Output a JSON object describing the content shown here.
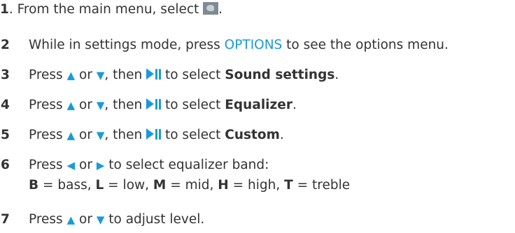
{
  "steps": [
    {
      "number": "1",
      "parts": {
        "prefix": "1",
        "text": ". From the main menu, select",
        "suffix": "."
      },
      "icon": "settings-menu-icon"
    },
    {
      "number": "2",
      "text_before": "While in settings mode, press ",
      "accent": "OPTIONS",
      "text_after": " to see the options menu."
    },
    {
      "number": "3",
      "press": "Press ",
      "or": " or ",
      "then": ", then ",
      "to_select": " to select ",
      "target": "Sound settings",
      "end": "."
    },
    {
      "number": "4",
      "press": "Press ",
      "or": " or ",
      "then": ", then ",
      "to_select": " to select ",
      "target": "Equalizer",
      "end": "."
    },
    {
      "number": "5",
      "press": "Press ",
      "or": " or ",
      "then": ", then ",
      "to_select": " to select ",
      "target": "Custom",
      "end": "."
    },
    {
      "number": "6",
      "line1_press": "Press ",
      "line1_or": " or ",
      "line1_rest": " to select equalizer band:",
      "bands": [
        {
          "key": "B",
          "label": " = bass"
        },
        {
          "key": "L",
          "label": " = low"
        },
        {
          "key": "M",
          "label": " = mid"
        },
        {
          "key": "H",
          "label": " = high"
        },
        {
          "key": "T",
          "label": " = treble"
        }
      ],
      "sep": ", "
    },
    {
      "number": "7",
      "press": "Press ",
      "or": " or ",
      "rest": " to adjust level."
    }
  ],
  "symbols": {
    "up": "▲",
    "down": "▼",
    "left": "◀",
    "right": "▶"
  },
  "colors": {
    "accent": "#1a9ad6",
    "text": "#333333"
  }
}
